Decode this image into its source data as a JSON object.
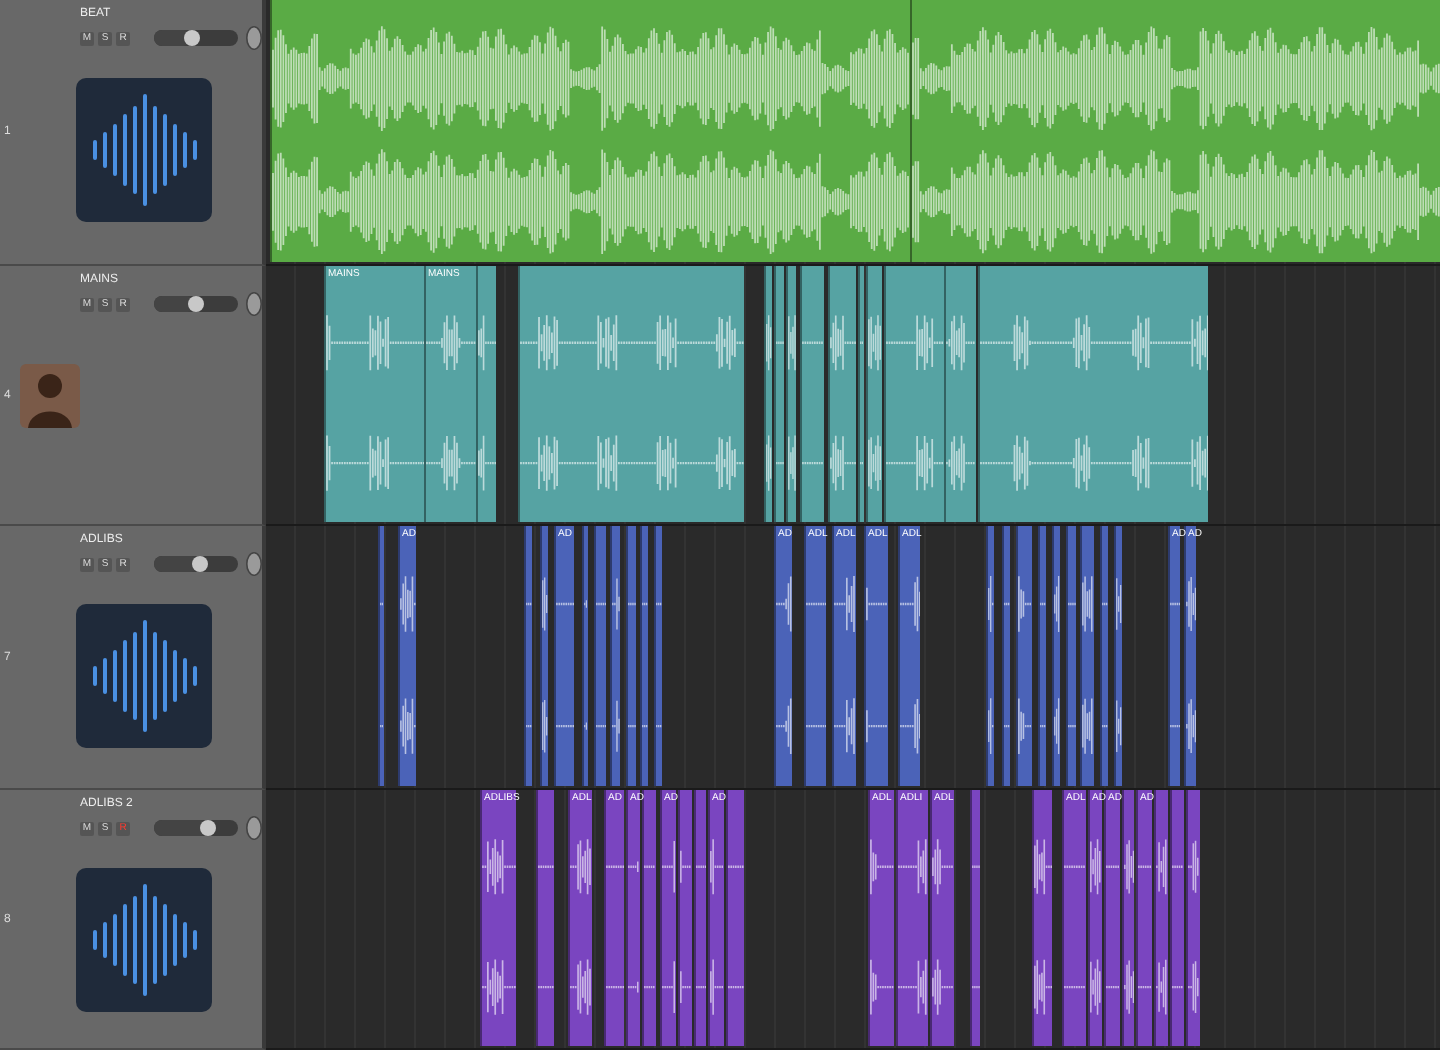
{
  "tracks": [
    {
      "kind": "waveform",
      "number": "1",
      "name": "BEAT",
      "buttons": [
        {
          "label": "M",
          "on": false
        },
        {
          "label": "S",
          "on": false
        },
        {
          "label": "R",
          "on": false
        }
      ],
      "volume": {
        "level": 0.45
      },
      "color": "#5aab45",
      "regions": [
        {
          "kind": "audio"
        },
        {
          "kind": "audio"
        }
      ]
    },
    {
      "kind": "avatar",
      "number": "4",
      "name": "MAINS",
      "buttons": [
        {
          "label": "M",
          "on": false
        },
        {
          "label": "S",
          "on": false
        },
        {
          "label": "R",
          "on": false
        }
      ],
      "volume": {
        "level": 0.5
      },
      "color": "#56a3a3",
      "regions": [
        {
          "kind": "audio",
          "label": "MAINS"
        },
        {
          "kind": "audio",
          "label": "MAINS"
        },
        {
          "kind": "audio"
        },
        {
          "kind": "audio"
        },
        {
          "kind": "audio"
        },
        {
          "kind": "audio"
        },
        {
          "kind": "audio"
        },
        {
          "kind": "audio"
        },
        {
          "kind": "audio"
        },
        {
          "kind": "audio"
        },
        {
          "kind": "audio"
        },
        {
          "kind": "audio"
        },
        {
          "kind": "audio"
        },
        {
          "kind": "audio"
        }
      ]
    },
    {
      "kind": "waveform",
      "number": "7",
      "name": "ADLIBS",
      "buttons": [
        {
          "label": "M",
          "on": false
        },
        {
          "label": "S",
          "on": false
        },
        {
          "label": "R",
          "on": false
        }
      ],
      "volume": {
        "level": 0.55
      },
      "color": "#4b63b8",
      "regions": [
        {
          "kind": "audio"
        },
        {
          "kind": "audio",
          "label": "AD"
        },
        {
          "kind": "audio"
        },
        {
          "kind": "audio"
        },
        {
          "kind": "audio",
          "label": "AD"
        },
        {
          "kind": "audio"
        },
        {
          "kind": "audio"
        },
        {
          "kind": "audio"
        },
        {
          "kind": "audio"
        },
        {
          "kind": "audio"
        },
        {
          "kind": "audio"
        },
        {
          "kind": "audio",
          "label": "AD"
        },
        {
          "kind": "audio",
          "label": "ADL"
        },
        {
          "kind": "audio",
          "label": "ADL"
        },
        {
          "kind": "audio",
          "label": "ADL"
        },
        {
          "kind": "audio",
          "label": "ADL"
        },
        {
          "kind": "audio"
        },
        {
          "kind": "audio"
        },
        {
          "kind": "audio"
        },
        {
          "kind": "audio"
        },
        {
          "kind": "audio"
        },
        {
          "kind": "audio"
        },
        {
          "kind": "audio"
        },
        {
          "kind": "audio"
        },
        {
          "kind": "audio"
        },
        {
          "kind": "audio",
          "label": "AD"
        },
        {
          "kind": "audio",
          "label": "AD"
        }
      ]
    },
    {
      "kind": "waveform",
      "number": "8",
      "name": "ADLIBS 2",
      "buttons": [
        {
          "label": "M",
          "on": false
        },
        {
          "label": "S",
          "on": false
        },
        {
          "label": "R",
          "on": true
        }
      ],
      "volume": {
        "level": 0.65
      },
      "color": "#7a45c0",
      "regions": [
        {
          "kind": "audio",
          "label": "ADLIBS"
        },
        {
          "kind": "audio"
        },
        {
          "kind": "audio",
          "label": "ADL"
        },
        {
          "kind": "audio",
          "label": "AD"
        },
        {
          "kind": "audio",
          "label": "AD"
        },
        {
          "kind": "audio"
        },
        {
          "kind": "audio",
          "label": "AD"
        },
        {
          "kind": "audio"
        },
        {
          "kind": "audio"
        },
        {
          "kind": "audio",
          "label": "AD"
        },
        {
          "kind": "audio"
        },
        {
          "kind": "audio",
          "label": "ADL"
        },
        {
          "kind": "audio",
          "label": "ADLI"
        },
        {
          "kind": "audio",
          "label": "ADL"
        },
        {
          "kind": "audio"
        },
        {
          "kind": "audio"
        },
        {
          "kind": "audio",
          "label": "ADL"
        },
        {
          "kind": "audio",
          "label": "AD"
        },
        {
          "kind": "audio",
          "label": "AD"
        },
        {
          "kind": "audio"
        },
        {
          "kind": "audio",
          "label": "AD"
        },
        {
          "kind": "audio"
        },
        {
          "kind": "audio"
        },
        {
          "kind": "audio"
        }
      ]
    }
  ]
}
